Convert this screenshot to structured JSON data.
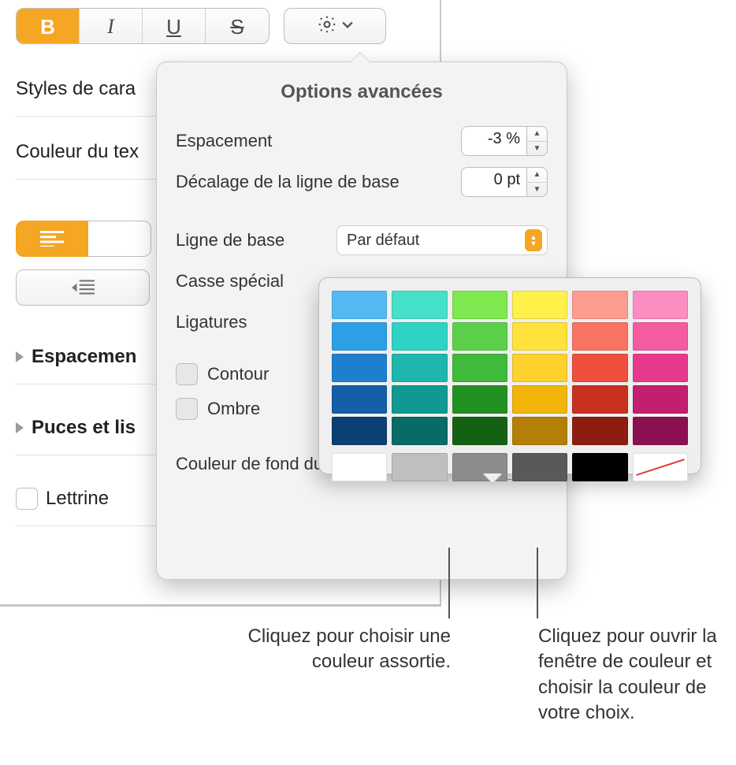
{
  "toolbar": {
    "bold": "B",
    "italic": "I",
    "underline": "U",
    "strike": "S"
  },
  "sidebar": {
    "styles_label": "Styles de cara",
    "color_label": "Couleur du tex",
    "spacing_section": "Espacemen",
    "bullets_section": "Puces et lis",
    "dropcap_label": "Lettrine"
  },
  "popover": {
    "title": "Options avancées",
    "spacing_label": "Espacement",
    "spacing_value": "-3 %",
    "baseline_offset_label": "Décalage de la ligne de base",
    "baseline_offset_value": "0 pt",
    "baseline_label": "Ligne de base",
    "baseline_value": "Par défaut",
    "case_label": "Casse spécial",
    "ligatures_label": "Ligatures",
    "outline_label": "Contour",
    "shadow_label": "Ombre",
    "bgcolor_label": "Couleur de fond du texte"
  },
  "callouts": {
    "left": "Cliquez pour choisir une couleur assortie.",
    "right": "Cliquez pour ouvrir la fenêtre de couleur et choisir la couleur de votre choix."
  },
  "palette_colors": {
    "main": [
      [
        "#54b8f2",
        "#45e0c8",
        "#7fe94f",
        "#fff04a",
        "#fc9d8f",
        "#fc8dc0"
      ],
      [
        "#2d9fe6",
        "#2fd3c6",
        "#5dd04b",
        "#ffe23b",
        "#f97363",
        "#f55ca0"
      ],
      [
        "#1e7fce",
        "#1fb7ad",
        "#3fba3a",
        "#ffd12c",
        "#ef4f3b",
        "#e83a8b"
      ],
      [
        "#145fa5",
        "#0f9992",
        "#239122",
        "#f2b409",
        "#c9301e",
        "#c21f71"
      ],
      [
        "#0c3f74",
        "#086b65",
        "#146113",
        "#b37f05",
        "#8d1d10",
        "#8c1151"
      ]
    ],
    "gray": [
      "#ffffff",
      "#bfbfbf",
      "#8c8c8c",
      "#595959",
      "#000000",
      "none"
    ]
  }
}
